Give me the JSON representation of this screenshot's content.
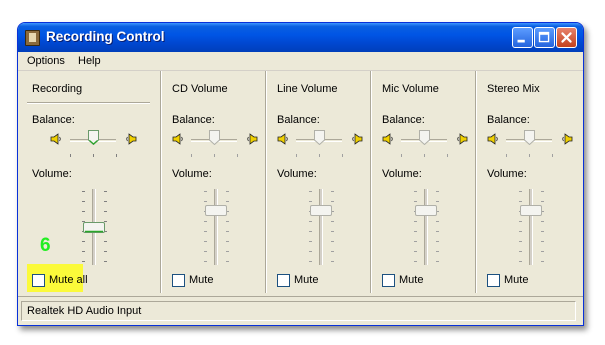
{
  "window": {
    "title": "Recording Control",
    "controls": {
      "minimize": "minimize",
      "maximize": "maximize",
      "close": "close"
    }
  },
  "menu": {
    "items": [
      "Options",
      "Help"
    ]
  },
  "recording": {
    "title": "Recording",
    "balance_label": "Balance:",
    "volume_label": "Volume:",
    "mute_all_label": "Mute all",
    "mute_all_checked": false,
    "step_marker": "6",
    "highlight_color": "#fbfa3a",
    "marker_color": "#22ee22"
  },
  "channels": [
    {
      "title": "CD Volume",
      "balance_label": "Balance:",
      "volume_label": "Volume:",
      "mute_label": "Mute",
      "mute_checked": false,
      "enabled": false
    },
    {
      "title": "Line Volume",
      "balance_label": "Balance:",
      "volume_label": "Volume:",
      "mute_label": "Mute",
      "mute_checked": false,
      "enabled": false
    },
    {
      "title": "Mic Volume",
      "balance_label": "Balance:",
      "volume_label": "Volume:",
      "mute_label": "Mute",
      "mute_checked": false,
      "enabled": false
    },
    {
      "title": "Stereo Mix",
      "balance_label": "Balance:",
      "volume_label": "Volume:",
      "mute_label": "Mute",
      "mute_checked": false,
      "enabled": false
    }
  ],
  "status": {
    "text": "Realtek HD Audio Input"
  }
}
